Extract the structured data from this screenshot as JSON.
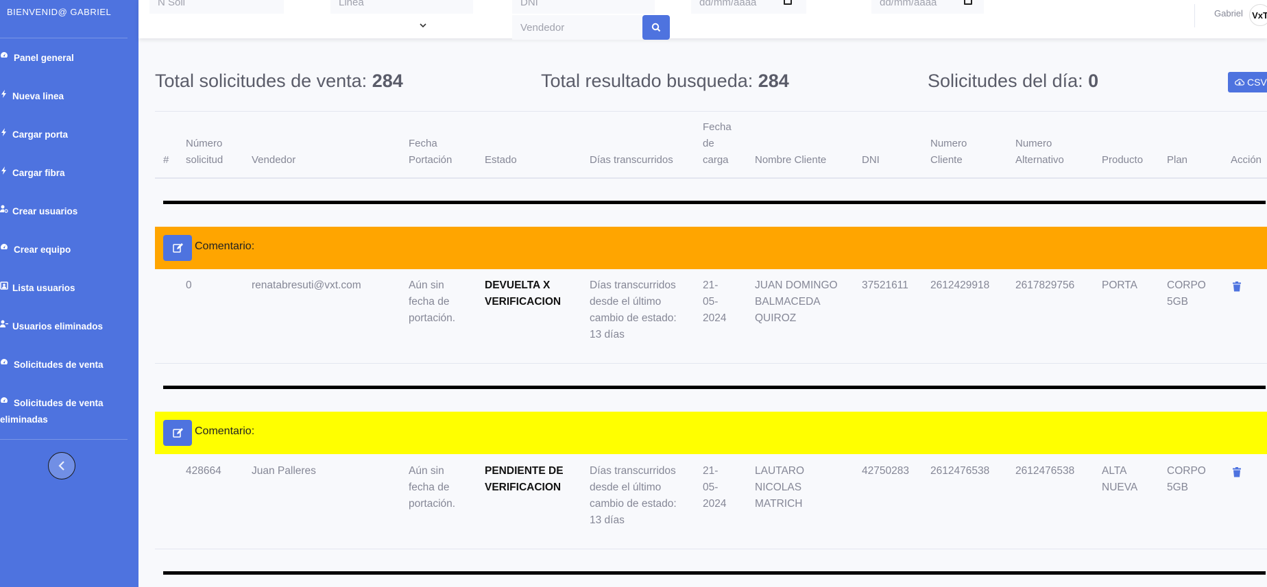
{
  "sidebar": {
    "brand": "BIENVENID@ GABRIEL",
    "items": [
      {
        "label": "Panel general",
        "icon": "gauge-icon"
      },
      {
        "label": "Nueva linea",
        "icon": "bolt-icon"
      },
      {
        "label": "Cargar porta",
        "icon": "bolt-icon"
      },
      {
        "label": "Cargar fibra",
        "icon": "bolt-icon"
      },
      {
        "label": "Crear usuarios",
        "icon": "user-cog-icon"
      },
      {
        "label": "Crear equipo",
        "icon": "gauge-icon"
      },
      {
        "label": "Lista usuarios",
        "icon": "address-card-icon"
      },
      {
        "label": "Usuarios eliminados",
        "icon": "user-minus-icon"
      },
      {
        "label": "Solicitudes de venta",
        "icon": "gauge-icon"
      },
      {
        "label": "Solicitudes de venta",
        "label2": "eliminadas",
        "icon": "gauge-icon"
      }
    ],
    "toggle_icon": "chevron-left-icon"
  },
  "topbar": {
    "n_soli_placeholder": "N Soli",
    "linea_placeholder": "Linea",
    "dni_placeholder": "DNI",
    "date_from_placeholder": "dd/mm/aaaa",
    "date_to_placeholder": "dd/mm/aaaa",
    "vendedor_placeholder": "Vendedor",
    "select_value": "",
    "user_name": "Gabriel",
    "avatar_text": "VxT"
  },
  "stats": {
    "total_label": "Total solicitudes de venta:",
    "total_value": "284",
    "search_label": "Total resultado busqueda:",
    "search_value": "284",
    "day_label": "Solicitudes del día:",
    "day_value": "0",
    "csv_label": "CSV"
  },
  "table": {
    "headers": {
      "hash": "#",
      "numero_l1": "Número",
      "numero_l2": "solicitud",
      "vendedor": "Vendedor",
      "fecha_port_l1": "Fecha",
      "fecha_port_l2": "Portación",
      "estado": "Estado",
      "dias": "Días transcurridos",
      "fecha_carga_l1": "Fecha",
      "fecha_carga_l2": "de",
      "fecha_carga_l3": "carga",
      "nombre": "Nombre Cliente",
      "dni": "DNI",
      "num_cliente_l1": "Numero",
      "num_cliente_l2": "Cliente",
      "num_alt_l1": "Numero",
      "num_alt_l2": "Alternativo",
      "producto": "Producto",
      "plan": "Plan",
      "accion": "Acción"
    },
    "comment_label": "Comentario:",
    "comment_colors": [
      "#ffa500",
      "#ffff00"
    ],
    "rows": [
      {
        "numero": "0",
        "vendedor": "renatabresuti@vxt.com",
        "fecha_port": [
          "Aún sin",
          "fecha de",
          "portación."
        ],
        "estado": [
          "DEVUELTA X",
          "VERIFICACION"
        ],
        "dias": [
          "Días transcurridos",
          "desde el último",
          "cambio de estado:",
          "13 días"
        ],
        "fecha_carga": [
          "21-",
          "05-",
          "2024"
        ],
        "nombre": [
          "JUAN DOMINGO",
          "BALMACEDA",
          "QUIROZ"
        ],
        "dni": "37521611",
        "num_cliente": "2612429918",
        "num_alt": "2617829756",
        "producto": [
          "PORTA"
        ],
        "plan": [
          "CORPO",
          "5GB"
        ]
      },
      {
        "numero": "428664",
        "vendedor": "Juan Palleres",
        "fecha_port": [
          "Aún sin",
          "fecha de",
          "portación."
        ],
        "estado": [
          "PENDIENTE DE",
          "VERIFICACION"
        ],
        "dias": [
          "Días transcurridos",
          "desde el último",
          "cambio de estado:",
          "13 días"
        ],
        "fecha_carga": [
          "21-",
          "05-",
          "2024"
        ],
        "nombre": [
          "LAUTARO",
          "NICOLAS",
          "MATRICH"
        ],
        "dni": "42750283",
        "num_cliente": "2612476538",
        "num_alt": "2612476538",
        "producto": [
          "ALTA",
          "NUEVA"
        ],
        "plan": [
          "CORPO",
          "5GB"
        ]
      }
    ]
  }
}
